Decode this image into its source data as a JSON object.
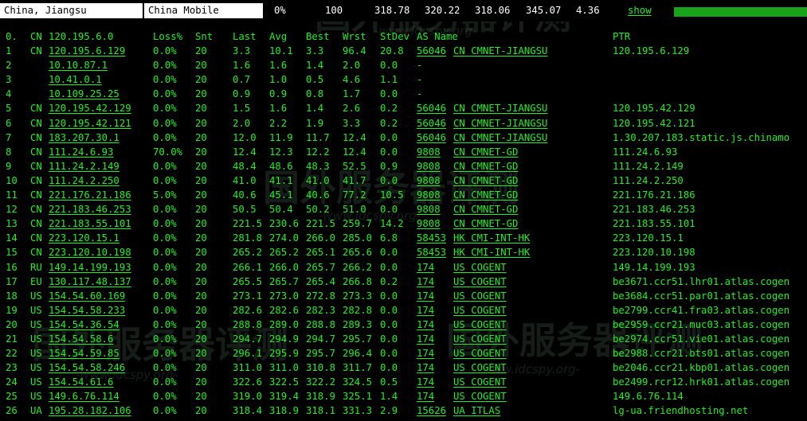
{
  "header": {
    "location": "China, Jiangsu",
    "isp": "China Mobile",
    "loss": "0%",
    "sent": "100",
    "avg": "318.78",
    "best_avg": "320.22",
    "best": "318.06",
    "worst": "345.07",
    "stdev": "4.36",
    "show_label": "show",
    "progress_fraction": 1.0
  },
  "columns": {
    "hop": "0.",
    "cc": "CN",
    "host": "120.195.6.0",
    "loss": "Loss%",
    "snt": "Snt",
    "last": "Last",
    "avg": "Avg",
    "best": "Best",
    "wrst": "Wrst",
    "stdev": "StDev",
    "as_name": "AS Name",
    "ptr": "PTR"
  },
  "rows": [
    {
      "hop": "1",
      "cc": "CN",
      "host": "120.195.6.129",
      "loss": "0.0%",
      "snt": "20",
      "last": "3.3",
      "avg": "10.1",
      "best": "3.3",
      "wrst": "96.4",
      "stdev": "20.8",
      "as": "56046",
      "as_cc": "CN",
      "as_name": "CMNET-JIANGSU",
      "ptr": "120.195.6.129"
    },
    {
      "hop": "2",
      "cc": "",
      "host": "10.10.87.1",
      "loss": "0.0%",
      "snt": "20",
      "last": "1.6",
      "avg": "1.6",
      "best": "1.4",
      "wrst": "2.0",
      "stdev": "0.0",
      "as": "-",
      "as_cc": "",
      "as_name": "",
      "ptr": ""
    },
    {
      "hop": "3",
      "cc": "",
      "host": "10.41.0.1",
      "loss": "0.0%",
      "snt": "20",
      "last": "0.7",
      "avg": "1.0",
      "best": "0.5",
      "wrst": "4.6",
      "stdev": "1.1",
      "as": "-",
      "as_cc": "",
      "as_name": "",
      "ptr": ""
    },
    {
      "hop": "4",
      "cc": "",
      "host": "10.109.25.25",
      "loss": "0.0%",
      "snt": "20",
      "last": "0.9",
      "avg": "0.9",
      "best": "0.8",
      "wrst": "1.7",
      "stdev": "0.0",
      "as": "-",
      "as_cc": "",
      "as_name": "",
      "ptr": ""
    },
    {
      "hop": "5",
      "cc": "CN",
      "host": "120.195.42.129",
      "loss": "0.0%",
      "snt": "20",
      "last": "1.5",
      "avg": "1.6",
      "best": "1.4",
      "wrst": "2.6",
      "stdev": "0.2",
      "as": "56046",
      "as_cc": "CN",
      "as_name": "CMNET-JIANGSU",
      "ptr": "120.195.42.129"
    },
    {
      "hop": "6",
      "cc": "CN",
      "host": "120.195.42.121",
      "loss": "0.0%",
      "snt": "20",
      "last": "2.0",
      "avg": "2.2",
      "best": "1.9",
      "wrst": "3.3",
      "stdev": "0.2",
      "as": "56046",
      "as_cc": "CN",
      "as_name": "CMNET-JIANGSU",
      "ptr": "120.195.42.121"
    },
    {
      "hop": "7",
      "cc": "CN",
      "host": "183.207.30.1",
      "loss": "0.0%",
      "snt": "20",
      "last": "12.0",
      "avg": "11.9",
      "best": "11.7",
      "wrst": "12.4",
      "stdev": "0.0",
      "as": "56046",
      "as_cc": "CN",
      "as_name": "CMNET-JIANGSU",
      "ptr": "1.30.207.183.static.js.chinamo"
    },
    {
      "hop": "8",
      "cc": "CN",
      "host": "111.24.6.93",
      "loss": "70.0%",
      "snt": "20",
      "last": "12.4",
      "avg": "12.3",
      "best": "12.2",
      "wrst": "12.4",
      "stdev": "0.0",
      "as": "9808",
      "as_cc": "CN",
      "as_name": "CMNET-GD",
      "ptr": "111.24.6.93"
    },
    {
      "hop": "9",
      "cc": "CN",
      "host": "111.24.2.149",
      "loss": "0.0%",
      "snt": "20",
      "last": "48.4",
      "avg": "48.6",
      "best": "48.3",
      "wrst": "52.5",
      "stdev": "0.9",
      "as": "9808",
      "as_cc": "CN",
      "as_name": "CMNET-GD",
      "ptr": "111.24.2.149"
    },
    {
      "hop": "10",
      "cc": "CN",
      "host": "111.24.2.250",
      "loss": "0.0%",
      "snt": "20",
      "last": "41.0",
      "avg": "41.1",
      "best": "41.0",
      "wrst": "41.7",
      "stdev": "0.0",
      "as": "9808",
      "as_cc": "CN",
      "as_name": "CMNET-GD",
      "ptr": "111.24.2.250"
    },
    {
      "hop": "11",
      "cc": "CN",
      "host": "221.176.21.186",
      "loss": "5.0%",
      "snt": "20",
      "last": "40.6",
      "avg": "45.1",
      "best": "40.6",
      "wrst": "77.2",
      "stdev": "10.5",
      "as": "9808",
      "as_cc": "CN",
      "as_name": "CMNET-GD",
      "ptr": "221.176.21.186"
    },
    {
      "hop": "12",
      "cc": "CN",
      "host": "221.183.46.253",
      "loss": "0.0%",
      "snt": "20",
      "last": "50.5",
      "avg": "50.4",
      "best": "50.2",
      "wrst": "51.0",
      "stdev": "0.0",
      "as": "9808",
      "as_cc": "CN",
      "as_name": "CMNET-GD",
      "ptr": "221.183.46.253"
    },
    {
      "hop": "13",
      "cc": "CN",
      "host": "221.183.55.101",
      "loss": "0.0%",
      "snt": "20",
      "last": "221.5",
      "avg": "230.6",
      "best": "221.5",
      "wrst": "259.7",
      "stdev": "14.2",
      "as": "9808",
      "as_cc": "CN",
      "as_name": "CMNET-GD",
      "ptr": "221.183.55.101"
    },
    {
      "hop": "14",
      "cc": "CN",
      "host": "223.120.15.1",
      "loss": "0.0%",
      "snt": "20",
      "last": "281.8",
      "avg": "274.0",
      "best": "266.0",
      "wrst": "285.0",
      "stdev": "6.8",
      "as": "58453",
      "as_cc": "HK",
      "as_name": "CMI-INT-HK",
      "ptr": "223.120.15.1"
    },
    {
      "hop": "15",
      "cc": "CN",
      "host": "223.120.10.198",
      "loss": "0.0%",
      "snt": "20",
      "last": "265.2",
      "avg": "265.2",
      "best": "265.1",
      "wrst": "265.6",
      "stdev": "0.0",
      "as": "58453",
      "as_cc": "HK",
      "as_name": "CMI-INT-HK",
      "ptr": "223.120.10.198"
    },
    {
      "hop": "16",
      "cc": "RU",
      "host": "149.14.199.193",
      "loss": "0.0%",
      "snt": "20",
      "last": "266.1",
      "avg": "266.0",
      "best": "265.7",
      "wrst": "266.2",
      "stdev": "0.0",
      "as": "174",
      "as_cc": "US",
      "as_name": "COGENT",
      "ptr": "149.14.199.193"
    },
    {
      "hop": "17",
      "cc": "EU",
      "host": "130.117.48.137",
      "loss": "0.0%",
      "snt": "20",
      "last": "265.5",
      "avg": "265.7",
      "best": "265.4",
      "wrst": "266.8",
      "stdev": "0.2",
      "as": "174",
      "as_cc": "US",
      "as_name": "COGENT",
      "ptr": "be3671.ccr51.lhr01.atlas.cogen"
    },
    {
      "hop": "18",
      "cc": "US",
      "host": "154.54.60.169",
      "loss": "0.0%",
      "snt": "20",
      "last": "273.1",
      "avg": "273.0",
      "best": "272.8",
      "wrst": "273.3",
      "stdev": "0.0",
      "as": "174",
      "as_cc": "US",
      "as_name": "COGENT",
      "ptr": "be3684.ccr51.par01.atlas.cogen"
    },
    {
      "hop": "19",
      "cc": "US",
      "host": "154.54.58.233",
      "loss": "0.0%",
      "snt": "20",
      "last": "282.6",
      "avg": "282.6",
      "best": "282.3",
      "wrst": "282.8",
      "stdev": "0.0",
      "as": "174",
      "as_cc": "US",
      "as_name": "COGENT",
      "ptr": "be2799.ccr41.fra03.atlas.cogen"
    },
    {
      "hop": "20",
      "cc": "US",
      "host": "154.54.36.54",
      "loss": "0.0%",
      "snt": "20",
      "last": "288.8",
      "avg": "289.0",
      "best": "288.8",
      "wrst": "289.3",
      "stdev": "0.0",
      "as": "174",
      "as_cc": "US",
      "as_name": "COGENT",
      "ptr": "be2959.ccr21.muc03.atlas.cogen"
    },
    {
      "hop": "21",
      "cc": "US",
      "host": "154.54.58.6",
      "loss": "0.0%",
      "snt": "20",
      "last": "294.7",
      "avg": "294.9",
      "best": "294.7",
      "wrst": "295.7",
      "stdev": "0.0",
      "as": "174",
      "as_cc": "US",
      "as_name": "COGENT",
      "ptr": "be2974.ccr51.vie01.atlas.cogen"
    },
    {
      "hop": "22",
      "cc": "US",
      "host": "154.54.59.85",
      "loss": "0.0%",
      "snt": "20",
      "last": "296.1",
      "avg": "295.9",
      "best": "295.7",
      "wrst": "296.4",
      "stdev": "0.0",
      "as": "174",
      "as_cc": "US",
      "as_name": "COGENT",
      "ptr": "be2988.ccr21.bts01.atlas.cogen"
    },
    {
      "hop": "23",
      "cc": "US",
      "host": "154.54.58.246",
      "loss": "0.0%",
      "snt": "20",
      "last": "311.0",
      "avg": "311.0",
      "best": "310.8",
      "wrst": "311.7",
      "stdev": "0.0",
      "as": "174",
      "as_cc": "US",
      "as_name": "COGENT",
      "ptr": "be2046.ccr21.kbp01.atlas.cogen"
    },
    {
      "hop": "24",
      "cc": "US",
      "host": "154.54.61.6",
      "loss": "0.0%",
      "snt": "20",
      "last": "322.6",
      "avg": "322.5",
      "best": "322.2",
      "wrst": "324.5",
      "stdev": "0.5",
      "as": "174",
      "as_cc": "US",
      "as_name": "COGENT",
      "ptr": "be2499.rcr12.hrk01.atlas.cogen"
    },
    {
      "hop": "25",
      "cc": "US",
      "host": "149.6.76.114",
      "loss": "0.0%",
      "snt": "20",
      "last": "319.0",
      "avg": "319.4",
      "best": "318.9",
      "wrst": "325.1",
      "stdev": "1.4",
      "as": "174",
      "as_cc": "US",
      "as_name": "COGENT",
      "ptr": "149.6.76.114"
    },
    {
      "hop": "26",
      "cc": "UA",
      "host": "195.28.182.106",
      "loss": "0.0%",
      "snt": "20",
      "last": "318.4",
      "avg": "318.9",
      "best": "318.1",
      "wrst": "331.3",
      "stdev": "2.9",
      "as": "15626",
      "as_cc": "UA",
      "as_name": "ITLAS",
      "ptr": "lg-ua.friendhosting.net"
    }
  ],
  "watermark": {
    "text_cn": "国外服务器评测",
    "text_url": "-www.idcspy.org-"
  },
  "colors": {
    "background": "#000000",
    "text": "#22ee22",
    "header_box": "#ffffff",
    "progress": "#1aa21a"
  }
}
